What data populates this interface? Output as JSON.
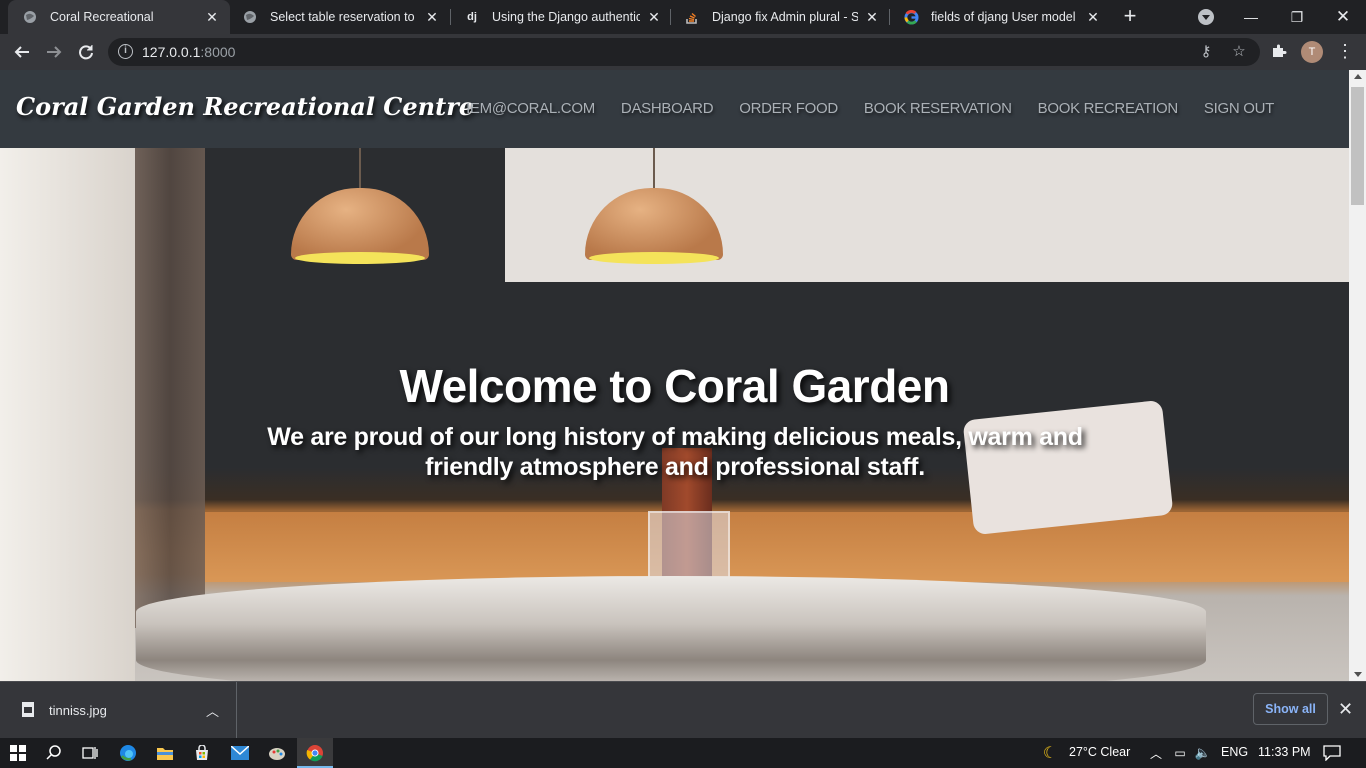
{
  "browser": {
    "tabs": [
      {
        "title": "Coral Recreational",
        "icon": "globe-icon",
        "active": true
      },
      {
        "title": "Select table reservation to ch",
        "icon": "globe-icon",
        "active": false
      },
      {
        "title": "Using the Django authenticat",
        "icon": "django-icon",
        "active": false
      },
      {
        "title": "Django fix Admin plural - Sta",
        "icon": "stackoverflow-icon",
        "active": false
      },
      {
        "title": "fields of djang User model - G",
        "icon": "google-icon",
        "active": false
      }
    ],
    "url_host": "127.0.0.1",
    "url_port": ":8000",
    "profile_initial": "T"
  },
  "site": {
    "brand": "Coral Garden Recreational Centre",
    "nav": [
      "IEM@CORAL.COM",
      "DASHBOARD",
      "ORDER FOOD",
      "BOOK RESERVATION",
      "BOOK RECREATION",
      "SIGN OUT"
    ],
    "hero_title": "Welcome to Coral Garden",
    "hero_subtitle": "We are proud of our long history of making delicious meals, warm and friendly atmosphere and professional staff."
  },
  "downloads": {
    "file_name": "tinniss.jpg",
    "show_all": "Show all"
  },
  "taskbar": {
    "weather": "27°C  Clear",
    "language": "ENG",
    "time": "11:33 PM"
  },
  "colors": {
    "navbar_bg": "#343a40",
    "nav_link": "#aab0b6",
    "show_all": "#8ab4f8"
  }
}
